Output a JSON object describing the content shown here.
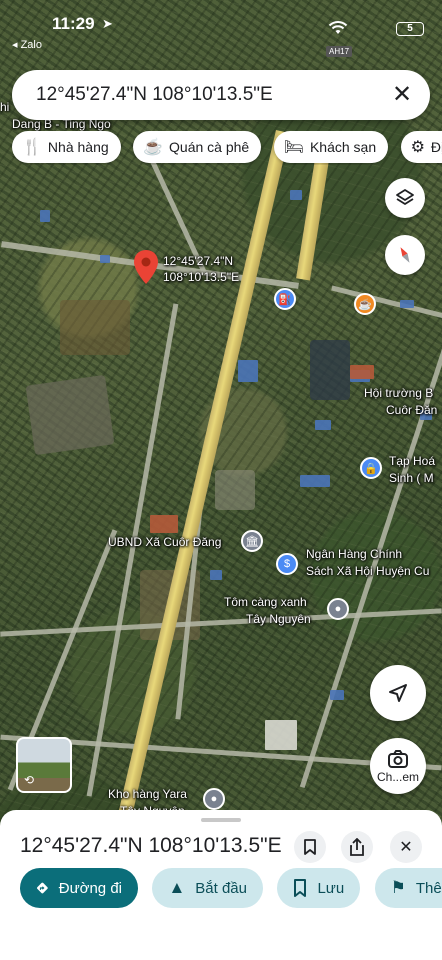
{
  "status_bar": {
    "time": "11:29",
    "back_app": "◂ Zalo",
    "battery": "5",
    "road_shield": "AH17"
  },
  "search": {
    "value": "12°45'27.4\"N 108°10'13.5\"E",
    "close_icon": "close-icon"
  },
  "chips": [
    {
      "label": "Nhà hàng",
      "icon": "fork-knife-icon"
    },
    {
      "label": "Quán cà phê",
      "icon": "coffee-icon"
    },
    {
      "label": "Khách sạn",
      "icon": "bed-icon"
    },
    {
      "label": "Địa đ",
      "icon": "attraction-icon"
    }
  ],
  "map": {
    "pin_label_line1": "12°45'27.4\"N",
    "pin_label_line2": "108°10'13.5\"E",
    "labels": {
      "top_left_1": "hi",
      "top_left_2": "Dang B - Ting Ngo",
      "hall_1": "Hội trường B",
      "hall_2": "Cuôr Đăn",
      "grocery_1": "Tạp Hoá",
      "grocery_2": "Sinh ( M",
      "ubnd": "UBND Xã Cuôr Đăng",
      "bank_1": "Ngân Hàng Chính",
      "bank_2": "Sách Xã Hội Huyện Cu",
      "shrimp_1": "Tôm càng xanh",
      "shrimp_2": "Tây Nguyên",
      "yara_1": "Kho hàng Yara",
      "yara_2": "Tây Nguyên"
    },
    "camera_label": "Ch...em"
  },
  "sheet": {
    "title": "12°45'27.4\"N 108°10'13.5\"E",
    "actions": [
      {
        "label": "Đường đi",
        "icon": "directions-icon"
      },
      {
        "label": "Bắt đầu",
        "icon": "navigation-arrow-icon"
      },
      {
        "label": "Lưu",
        "icon": "bookmark-icon"
      },
      {
        "label": "Thêm",
        "icon": "flag-icon"
      }
    ]
  },
  "colors": {
    "primary_action": "#0b6e7a",
    "secondary_action": "#cde7ec",
    "pin_red": "#ea4335",
    "main_road": "#e8d87a"
  }
}
